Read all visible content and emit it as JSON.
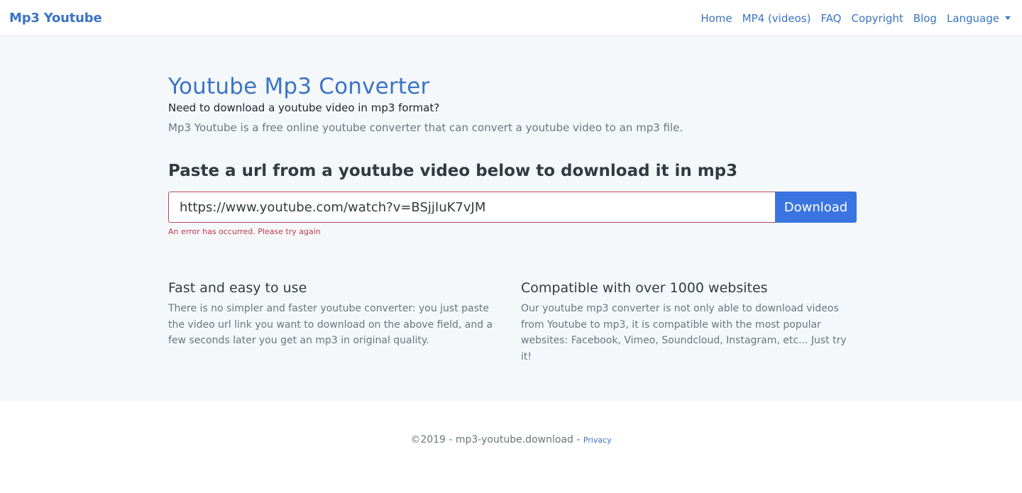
{
  "nav": {
    "brand": "Mp3 Youtube",
    "links": [
      {
        "label": "Home"
      },
      {
        "label": "MP4 (videos)"
      },
      {
        "label": "FAQ"
      },
      {
        "label": "Copyright"
      },
      {
        "label": "Blog"
      },
      {
        "label": "Language"
      }
    ]
  },
  "hero": {
    "title": "Youtube Mp3 Converter",
    "lead": "Need to download a youtube video in mp3 format?",
    "description": "Mp3 Youtube is a free online youtube converter that can convert a youtube video to an mp3 file.",
    "prompt": "Paste a url from a youtube video below to download it in mp3",
    "url_value": "https://www.youtube.com/watch?v=BSjjIuK7vJM",
    "download_label": "Download",
    "error_message": "An error has occurred. Please try again"
  },
  "features": [
    {
      "title": "Fast and easy to use",
      "text": "There is no simpler and faster youtube converter: you just paste the video url link you want to download on the above field, and a few seconds later you get an mp3 in original quality."
    },
    {
      "title": "Compatible with over 1000 websites",
      "text": "Our youtube mp3 converter is not only able to download videos from Youtube to mp3, it is compatible with the most popular websites: Facebook, Vimeo, Soundcloud, Instagram, etc... Just try it!"
    }
  ],
  "footer": {
    "copyright": "©2019 - mp3-youtube.download - ",
    "privacy_label": "Privacy"
  },
  "colors": {
    "accent": "#3a74c4",
    "button": "#3a74e0",
    "error": "#c0394b",
    "hero_bg": "#f5f8fb"
  }
}
